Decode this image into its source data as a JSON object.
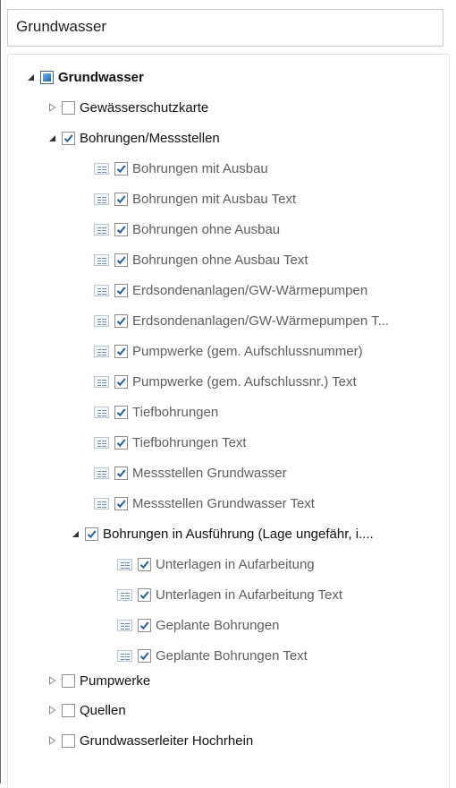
{
  "header": {
    "title": "Grundwasser"
  },
  "tree": {
    "root": {
      "label": "Grundwasser"
    },
    "gewaesserschutzkarte": {
      "label": "Gewässerschutzkarte"
    },
    "bohrungen_messstellen": {
      "label": "Bohrungen/Messstellen"
    },
    "layers": [
      "Bohrungen mit Ausbau",
      "Bohrungen mit Ausbau Text",
      "Bohrungen ohne Ausbau",
      "Bohrungen ohne Ausbau Text",
      "Erdsondenanlagen/GW-Wärmepumpen",
      "Erdsondenanlagen/GW-Wärmepumpen T...",
      "Pumpwerke (gem. Aufschlussnummer)",
      "Pumpwerke (gem. Aufschlussnr.) Text",
      "Tiefbohrungen",
      "Tiefbohrungen Text",
      "Messstellen Grundwasser",
      "Messstellen Grundwasser Text"
    ],
    "bohrungen_ausfuehrung": {
      "label": "Bohrungen in Ausführung (Lage ungefähr, i...."
    },
    "sublayers": [
      "Unterlagen in Aufarbeitung",
      "Unterlagen in Aufarbeitung Text",
      "Geplante Bohrungen",
      "Geplante Bohrungen Text"
    ],
    "pumpwerke": {
      "label": "Pumpwerke"
    },
    "quellen": {
      "label": "Quellen"
    },
    "grundwasserleiter": {
      "label": "Grundwasserleiter Hochrhein"
    }
  },
  "colors": {
    "check": "#1f5fa8",
    "accent": "#1e64b4"
  }
}
